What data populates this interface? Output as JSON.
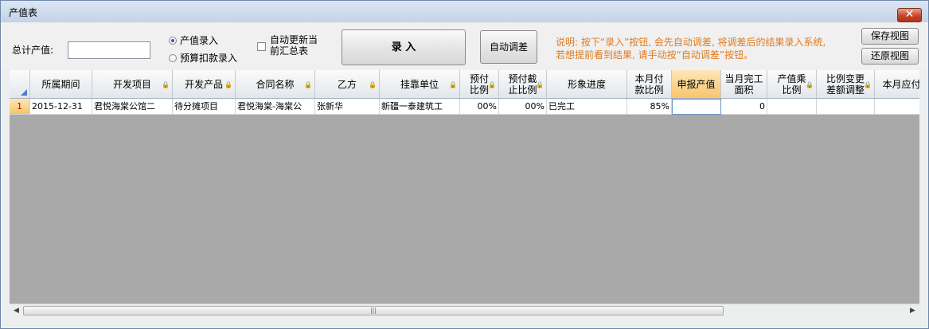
{
  "window": {
    "title": "产值表",
    "close_label": "✕"
  },
  "toolbar": {
    "total_label": "总计产值:",
    "total_value": "",
    "radio_output": "产值录入",
    "radio_budget": "预算扣款录入",
    "auto_update_label": "自动更新当前汇总表",
    "enter_button": "录 入",
    "auto_adjust_button": "自动调差",
    "note": "说明: 按下“录入”按钮, 会先自动调差, 将调差后的结果录入系统, 若想提前看到结果, 请手动按“自动调差”按钮。",
    "save_view_button": "保存视图",
    "restore_view_button": "还原视图"
  },
  "grid": {
    "columns": [
      {
        "label": "所属期间",
        "locked": false
      },
      {
        "label": "开发项目",
        "locked": true
      },
      {
        "label": "开发产品",
        "locked": true
      },
      {
        "label": "合同名称",
        "locked": true
      },
      {
        "label": "乙方",
        "locked": true
      },
      {
        "label": "挂靠单位",
        "locked": true
      },
      {
        "label": "预付\n比例",
        "locked": true
      },
      {
        "label": "预付截\n止比例",
        "locked": true
      },
      {
        "label": "形象进度",
        "locked": false
      },
      {
        "label": "本月付\n款比例",
        "locked": false
      },
      {
        "label": "申报产值",
        "locked": false
      },
      {
        "label": "当月完工\n面积",
        "locked": false
      },
      {
        "label": "产值乘\n比例",
        "locked": true
      },
      {
        "label": "比例变更\n差额调整",
        "locked": true
      },
      {
        "label": "本月应付款",
        "locked": false
      }
    ],
    "rows": [
      {
        "num": "1",
        "cells": [
          "2015-12-31",
          "君悦海棠公馆二",
          "待分摊项目",
          "君悦海棠-海棠公",
          "张新华",
          "新疆一泰建筑工",
          "00%",
          "00%",
          "已完工",
          "85%",
          "",
          "0",
          "",
          "",
          ""
        ]
      }
    ]
  },
  "scrollbar": {
    "left_arrow": "◀",
    "right_arrow": "▶",
    "thumb_grip": "|||"
  }
}
